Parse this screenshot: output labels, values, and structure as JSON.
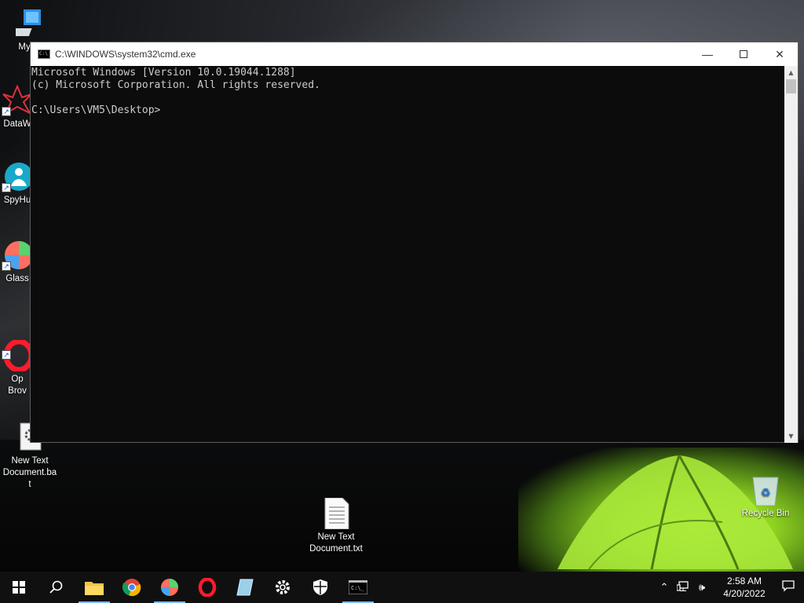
{
  "desktop": {
    "icons": [
      {
        "label": "My Co",
        "icon": "computer-icon"
      },
      {
        "label": "DataW",
        "icon": "datawrapper-icon"
      },
      {
        "label": "SpyHu",
        "icon": "spyhunter-icon"
      },
      {
        "label": "Glass",
        "icon": "glass-icon"
      },
      {
        "label": "Op\nBrov",
        "icon": "opera-icon"
      },
      {
        "label": "New Text\nDocument.ba\nt",
        "icon": "bat-file-icon"
      },
      {
        "label": "New Text\nDocument.txt",
        "icon": "text-file-icon"
      },
      {
        "label": "Recycle Bin",
        "icon": "recycle-bin-icon"
      }
    ]
  },
  "cmd": {
    "title": "C:\\WINDOWS\\system32\\cmd.exe",
    "lines": [
      "Microsoft Windows [Version 10.0.19044.1288]",
      "(c) Microsoft Corporation. All rights reserved.",
      "",
      "C:\\Users\\VM5\\Desktop>"
    ]
  },
  "taskbar": {
    "apps": [
      "start-icon",
      "search-icon",
      "file-explorer-icon",
      "chrome-icon",
      "glass-app-icon",
      "opera-icon",
      "notepad-icon",
      "settings-icon",
      "security-icon",
      "cmd-icon"
    ],
    "time": "2:58 AM",
    "date": "4/20/2022"
  },
  "colors": {
    "console_bg": "#0c0c0c",
    "console_text": "#cccccc",
    "taskbar_bg": "#101010",
    "accent": "#76b9ed"
  }
}
